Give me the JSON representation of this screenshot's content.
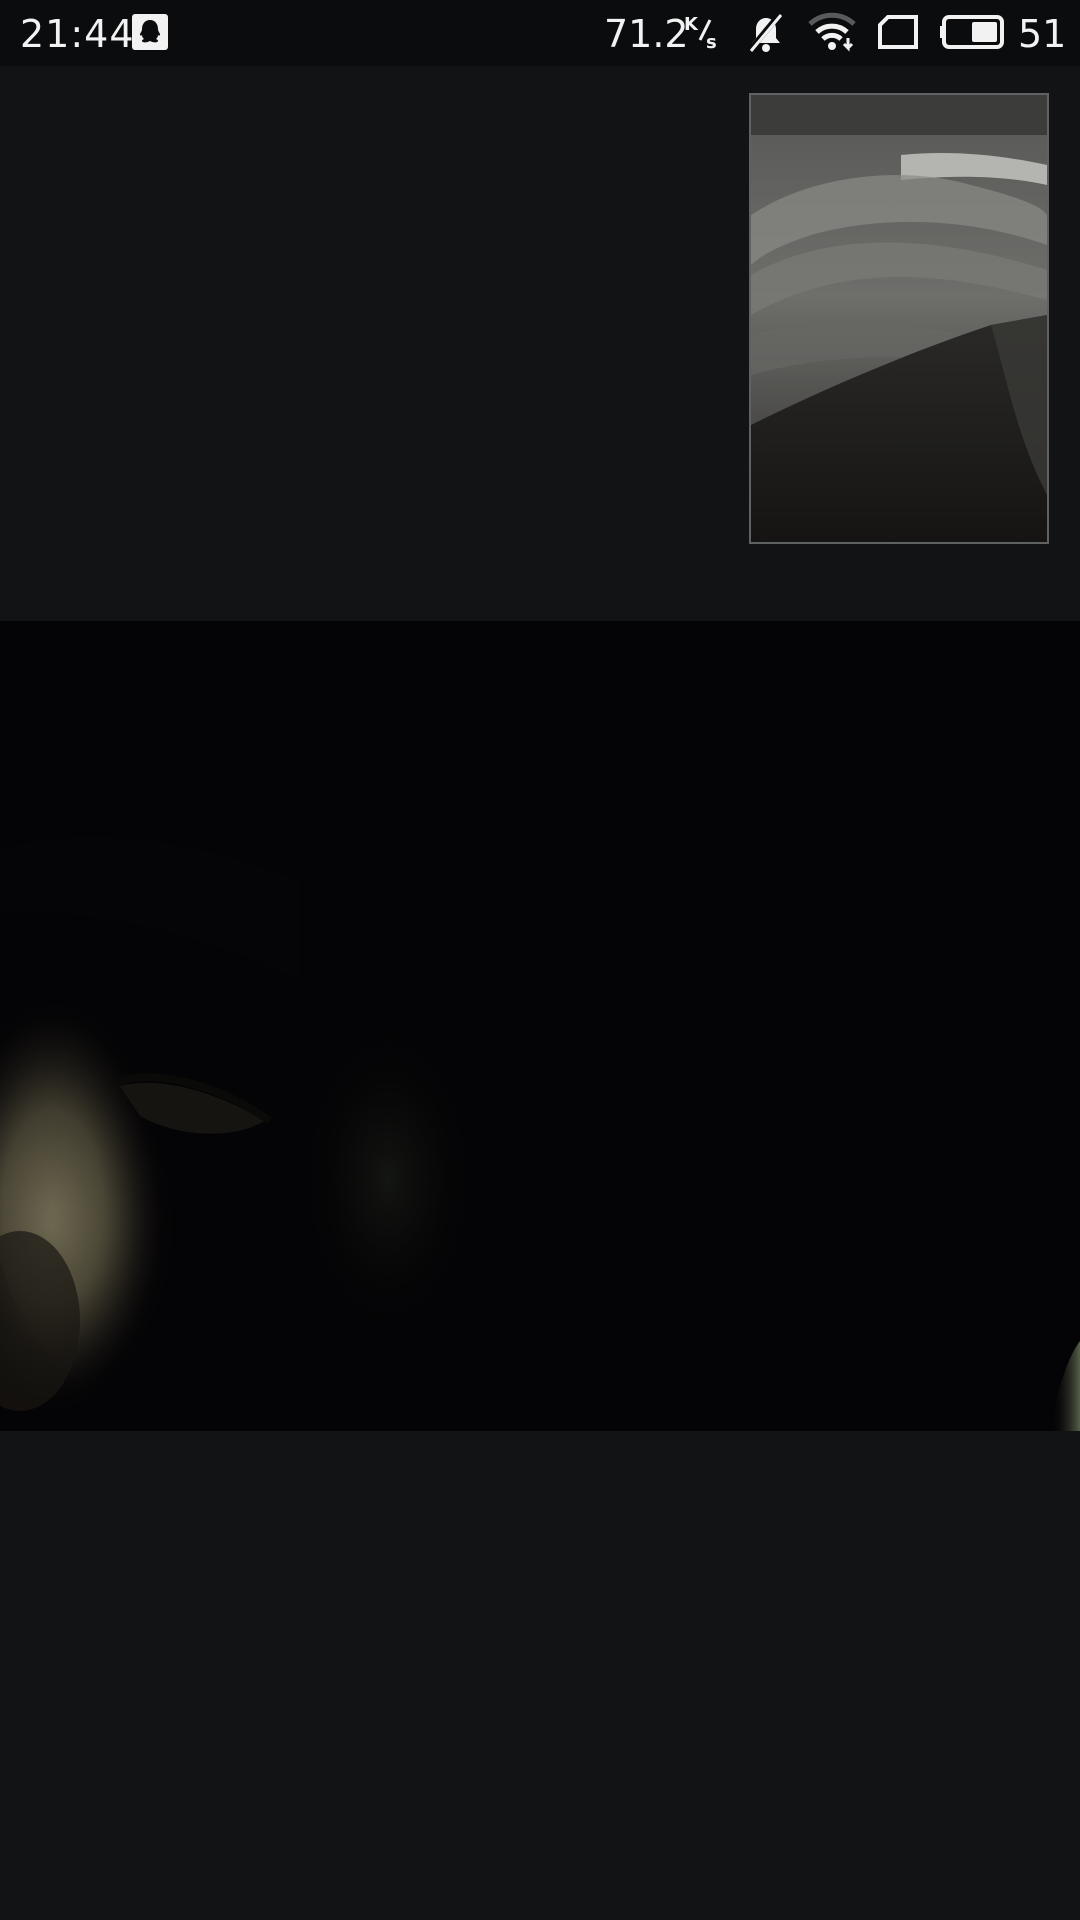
{
  "status_bar": {
    "time": "21:44",
    "network_speed": "71.2",
    "network_speed_unit": "K/s",
    "battery_level": "51",
    "icons": [
      "qq-icon",
      "mute-icon",
      "wifi-icon",
      "sim-icon",
      "battery-icon"
    ]
  },
  "video_call": {
    "remote_video": "remote-video-feed",
    "local_preview": "local-preview-feed"
  },
  "colors": {
    "background": "#121315",
    "status_bar": "#0b0c0e",
    "remote_video_bg": "#040305",
    "preview_border": "#606163"
  }
}
